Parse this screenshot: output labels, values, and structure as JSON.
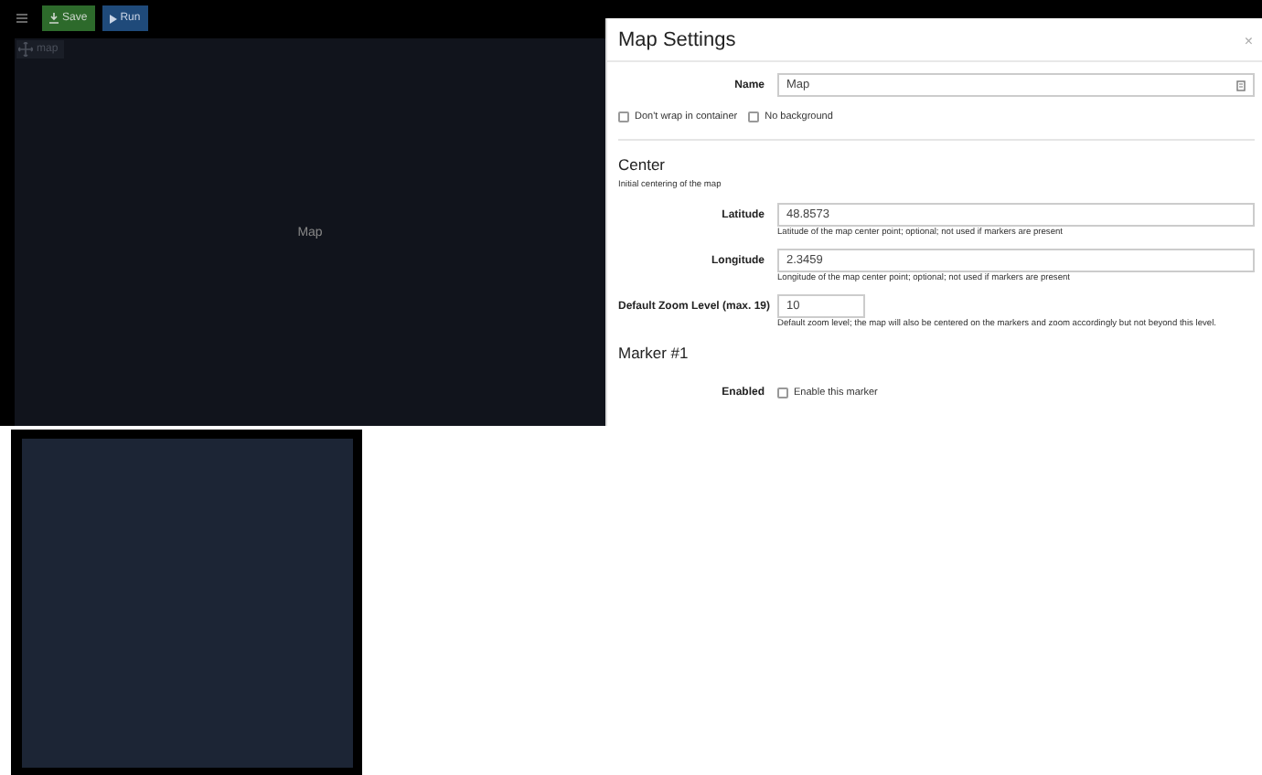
{
  "toolbar": {
    "buttons": [
      {
        "kind": "save",
        "label": "Save"
      },
      {
        "kind": "run",
        "label": "Run"
      }
    ]
  },
  "canvas": {
    "tag": "map",
    "placeholder_text": "Map"
  },
  "dialog": {
    "title": "Map Settings",
    "close": "×",
    "name_field": {
      "label": "Name",
      "value": "Map"
    },
    "options": [
      {
        "label": "Don't wrap in container",
        "checked": false
      },
      {
        "label": "No background",
        "checked": false
      }
    ],
    "sections": [
      {
        "title": "Center",
        "description": "Initial centering of the map",
        "fields": [
          {
            "label": "Latitude",
            "value": "48.8573",
            "help": "Latitude of the map center point; optional; not used if markers are present",
            "wide": true
          },
          {
            "label": "Longitude",
            "value": "2.3459",
            "help": "Longitude of the map center point; optional; not used if markers are present",
            "wide": true
          },
          {
            "label": "Default Zoom Level (max. 19)",
            "value": "10",
            "help": "Default zoom level; the map will also be centered on the markers and zoom accordingly but not beyond this level.",
            "wide": false
          }
        ]
      },
      {
        "title": "Marker #1",
        "enabled": {
          "label": "Enabled",
          "checkbox_label": "Enable this marker",
          "checked": false
        }
      }
    ]
  }
}
